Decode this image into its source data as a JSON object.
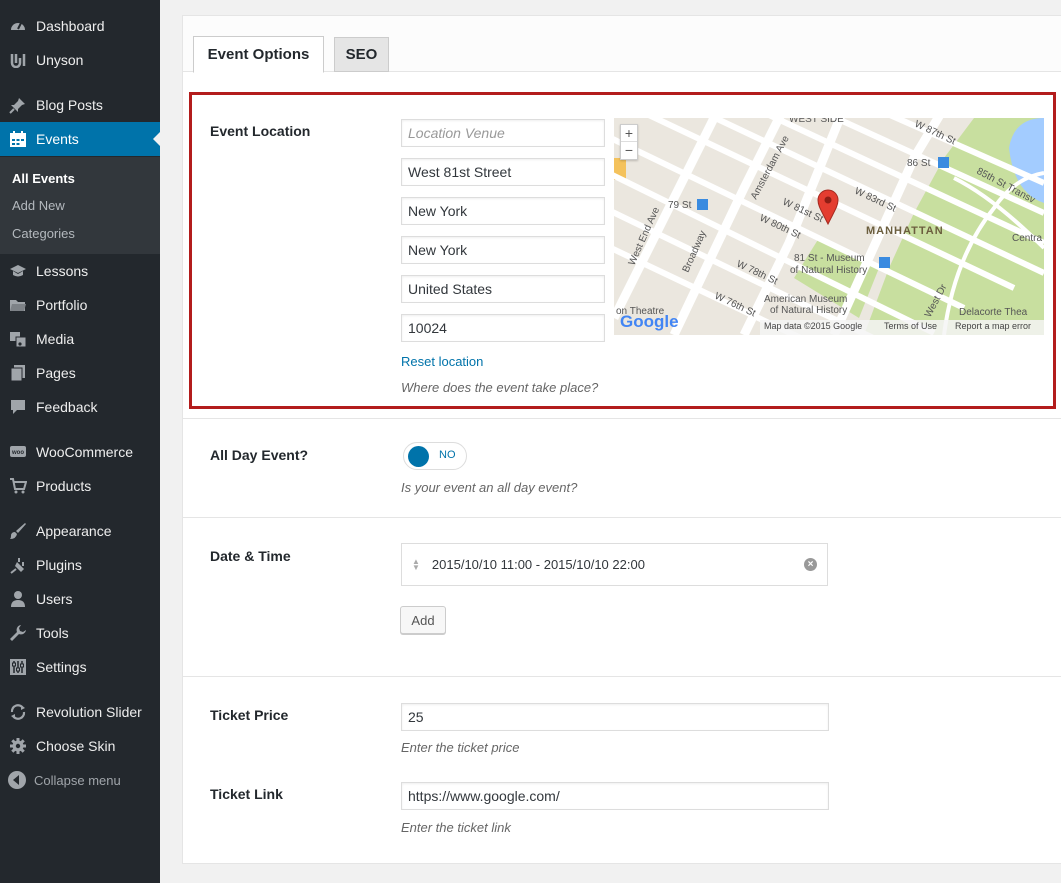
{
  "sidebar": {
    "items": [
      {
        "label": "Dashboard",
        "icon": "dashboard-icon"
      },
      {
        "label": "Unyson",
        "icon": "unyson-icon"
      },
      {
        "label": "Blog Posts",
        "icon": "pin-icon"
      },
      {
        "label": "Events",
        "icon": "calendar-icon"
      },
      {
        "label": "Lessons",
        "icon": "graduation-cap-icon"
      },
      {
        "label": "Portfolio",
        "icon": "folder-icon"
      },
      {
        "label": "Media",
        "icon": "media-icon"
      },
      {
        "label": "Pages",
        "icon": "pages-icon"
      },
      {
        "label": "Feedback",
        "icon": "speech-bubble-icon"
      },
      {
        "label": "WooCommerce",
        "icon": "woocommerce-icon"
      },
      {
        "label": "Products",
        "icon": "cart-icon"
      },
      {
        "label": "Appearance",
        "icon": "paintbrush-icon"
      },
      {
        "label": "Plugins",
        "icon": "plug-icon"
      },
      {
        "label": "Users",
        "icon": "user-icon"
      },
      {
        "label": "Tools",
        "icon": "wrench-icon"
      },
      {
        "label": "Settings",
        "icon": "sliders-icon"
      },
      {
        "label": "Revolution Slider",
        "icon": "refresh-icon"
      },
      {
        "label": "Choose Skin",
        "icon": "gear-icon"
      }
    ],
    "submenu": [
      "All Events",
      "Add New",
      "Categories"
    ],
    "collapse_label": "Collapse menu"
  },
  "tabs": [
    "Event Options",
    "SEO"
  ],
  "event_location": {
    "label": "Event Location",
    "venue_placeholder": "Location Venue",
    "street": "West 81st Street",
    "city": "New York",
    "state": "New York",
    "country": "United States",
    "zip": "10024",
    "reset_label": "Reset location",
    "hint": "Where does the event take place?"
  },
  "map": {
    "streets": [
      "Amsterdam Ave",
      "West End Ave",
      "Broadway",
      "W 81st St",
      "W 80th St",
      "W 83rd St",
      "W 78th St",
      "W 76th St",
      "West Dr",
      "85th St Transv",
      "W 87th St",
      "WEST SIDE",
      "Centra"
    ],
    "places": [
      "MANHATTAN",
      "81 St - Museum",
      "of Natural History",
      "American Museum",
      "of Natural History",
      "86 St",
      "79 St",
      "on Theatre",
      "Delacorte Thea"
    ],
    "attribution": [
      "Map data ©2015 Google",
      "Terms of Use",
      "Report a map error"
    ],
    "logo_text": "Google",
    "zoom_in": "+",
    "zoom_out": "−",
    "colors": {
      "land": "#ebe7df",
      "park": "#c8df9f",
      "water": "#a3ccff",
      "road": "#ffffff",
      "pin": "#e43d30"
    }
  },
  "all_day": {
    "label": "All Day Event?",
    "toggle_text": "NO",
    "hint": "Is your event an all day event?"
  },
  "date_time": {
    "label": "Date & Time",
    "value": "2015/10/10 11:00 - 2015/10/10 22:00",
    "remove_glyph": "×",
    "add_label": "Add"
  },
  "ticket_price": {
    "label": "Ticket Price",
    "value": "25",
    "hint": "Enter the ticket price"
  },
  "ticket_link": {
    "label": "Ticket Link",
    "value": "https://www.google.com/",
    "hint": "Enter the ticket link"
  },
  "colors": {
    "sidebar_bg": "#23282d",
    "active_bg": "#0073aa",
    "highlight_border": "#b31c1c"
  }
}
